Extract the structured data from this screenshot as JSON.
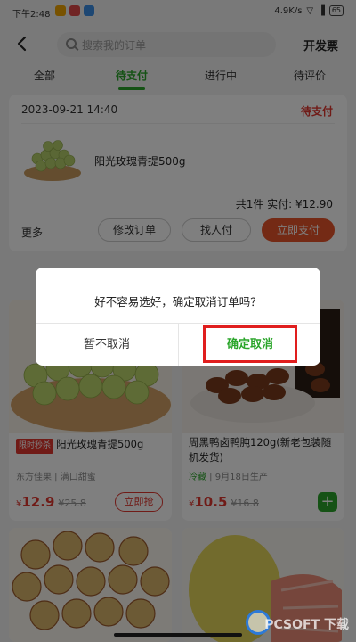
{
  "status_bar": {
    "time": "下午2:48",
    "network_speed": "4.9K/s",
    "battery": "65"
  },
  "header": {
    "search_placeholder": "搜索我的订单",
    "invoice_label": "开发票"
  },
  "tabs": [
    {
      "label": "全部"
    },
    {
      "label": "待支付"
    },
    {
      "label": "进行中"
    },
    {
      "label": "待评价"
    }
  ],
  "order": {
    "date": "2023-09-21 14:40",
    "status": "待支付",
    "product_name": "阳光玫瑰青提500g",
    "total": "共1件 实付: ¥12.90",
    "more_label": "更多",
    "modify_label": "修改订单",
    "find_payer_label": "找人付",
    "pay_label": "立即支付"
  },
  "recommendations": [
    {
      "badge": "限时秒杀",
      "title": "阳光玫瑰青提500g",
      "meta": "东方佳果 | 满口甜蜜",
      "price_symbol": "¥",
      "price": "12.9",
      "original_price": "¥25.8",
      "action_label": "立即抢"
    },
    {
      "title": "周黑鸭卤鸭肫120g(新老包装随机发货)",
      "meta_green": "冷藏",
      "meta": "9月18日生产",
      "price_symbol": "¥",
      "price": "10.5",
      "original_price": "¥16.8",
      "action_label": "+"
    }
  ],
  "dialog": {
    "message": "好不容易选好，确定取消订单吗？",
    "cancel_label": "暂不取消",
    "confirm_label": "确定取消"
  },
  "watermark": "PCSOFT 下载",
  "colors": {
    "accent_green": "#2aa52a",
    "alert_red": "#e0362e",
    "pay_orange": "#e8552a",
    "highlight_box": "#e01e1e"
  }
}
